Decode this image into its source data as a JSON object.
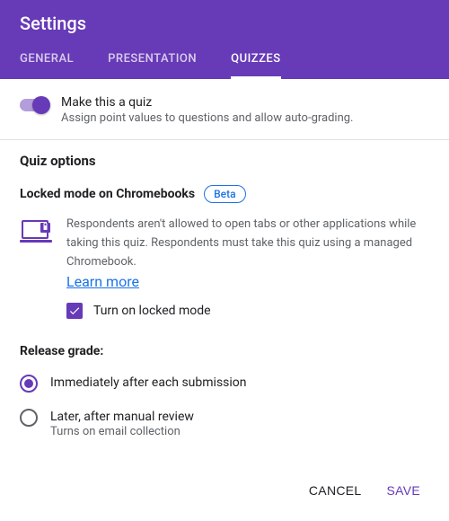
{
  "colors": {
    "primary": "#673ab7",
    "link": "#1a73e8"
  },
  "header": {
    "title": "Settings"
  },
  "tabs": {
    "general": "GENERAL",
    "presentation": "PRESENTATION",
    "quizzes": "QUIZZES",
    "active": "quizzes"
  },
  "quiz_toggle": {
    "label": "Make this a quiz",
    "description": "Assign point values to questions and allow auto-grading.",
    "enabled": true
  },
  "quiz_options": {
    "title": "Quiz options",
    "locked_mode": {
      "heading": "Locked mode on Chromebooks",
      "badge": "Beta",
      "description": "Respondents aren't allowed to open tabs or other applications while taking this quiz. Respondents must take this quiz using a managed Chromebook.",
      "learn_more": "Learn more",
      "checkbox_label": "Turn on locked mode",
      "checkbox_checked": true
    },
    "release_grade": {
      "title": "Release grade:",
      "options": [
        {
          "label": "Immediately after each submission",
          "sub": "",
          "selected": true
        },
        {
          "label": "Later, after manual review",
          "sub": "Turns on email collection",
          "selected": false
        }
      ]
    }
  },
  "footer": {
    "cancel": "CANCEL",
    "save": "SAVE"
  }
}
